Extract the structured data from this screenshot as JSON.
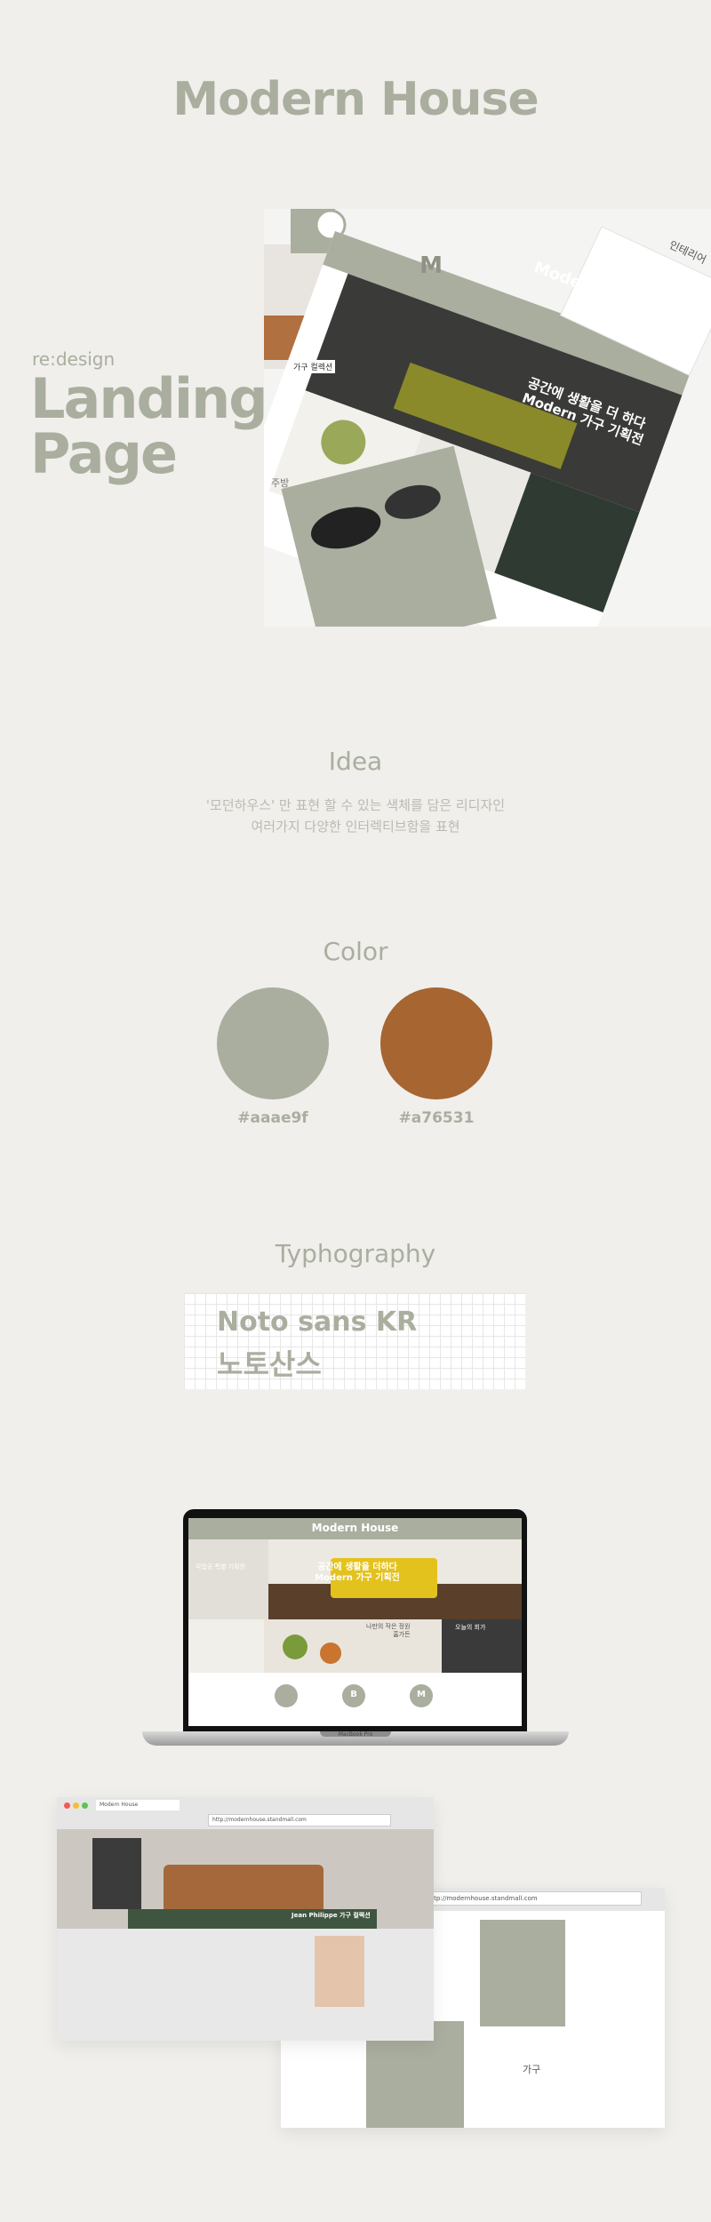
{
  "header": {
    "title": "Modern House"
  },
  "intro": {
    "kicker": "re:design",
    "heading_line1": "Landing",
    "heading_line2": "Page"
  },
  "hero_mock": {
    "brand": "Modern House",
    "tagline_line1": "공간에 생활을 더 하다",
    "tagline_line2": "Modern 가구 기획전",
    "side_label_1": "인테리어",
    "side_label_2": "주방",
    "side_label_3": "가구 컬렉션",
    "logo_letter": "M"
  },
  "idea": {
    "heading": "Idea",
    "line1": "'모던하우스' 만 표현 할 수 있는 색체를 담은 리디자인",
    "line2": "여러가지 다양한 인터렉티브함을 표현"
  },
  "color": {
    "heading": "Color",
    "swatches": [
      {
        "hex": "#aaae9f",
        "label": "#aaae9f"
      },
      {
        "hex": "#a76531",
        "label": "#a76531"
      }
    ]
  },
  "typography": {
    "heading": "Typhography",
    "font_name": "Noto sans KR",
    "font_name_kr": "노토산스"
  },
  "laptop_mock": {
    "brand": "Modern House",
    "tagline_line1": "공간에 생활을 더하다",
    "tagline_line2": "Modern 가구 기획전",
    "left_label": "작업공 특별 기획전",
    "mid_label_1": "나만의 작은 정원",
    "mid_label_2": "홈가든",
    "right_label": "오늘의 회가",
    "icon_b": "B",
    "icon_m": "M",
    "model": "MacBook Pro"
  },
  "browser_1": {
    "tab_label": "Modern House",
    "url": "http://modernhouse.standmall.com",
    "caption": "Jean Philippe 가구 컬렉션"
  },
  "browser_2": {
    "url": "http://modernhouse.standmall.com",
    "category": "가구"
  }
}
